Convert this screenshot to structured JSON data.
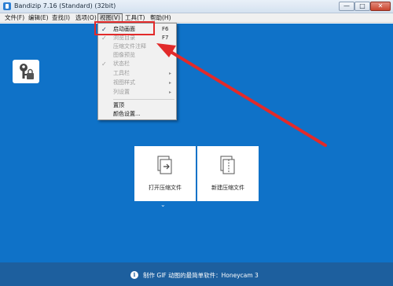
{
  "window": {
    "title": "Bandizip 7.16 (Standard) (32bit)",
    "controls": {
      "minimize": "—",
      "maximize": "□",
      "close": "✕"
    }
  },
  "menubar": {
    "items": [
      {
        "label": "文件(F)"
      },
      {
        "label": "编辑(E)"
      },
      {
        "label": "查找(I)"
      },
      {
        "label": "选项(O)"
      },
      {
        "label": "视图(V)"
      },
      {
        "label": "工具(T)"
      },
      {
        "label": "帮助(H)"
      }
    ]
  },
  "view_menu": {
    "items": [
      {
        "label": "启动画面",
        "shortcut": "F6",
        "checked": true,
        "enabled": true,
        "highlighted": true
      },
      {
        "label": "浏览目录",
        "shortcut": "F7",
        "checked": true,
        "enabled": false
      },
      {
        "label": "压缩文件注释",
        "shortcut": "",
        "checked": false,
        "enabled": false
      },
      {
        "label": "图像预览",
        "shortcut": "",
        "checked": false,
        "enabled": false
      },
      {
        "label": "状态栏",
        "shortcut": "",
        "checked": true,
        "enabled": false
      },
      {
        "label": "工具栏",
        "shortcut": "",
        "checked": false,
        "enabled": false,
        "submenu": true
      },
      {
        "label": "视图样式",
        "shortcut": "",
        "checked": false,
        "enabled": false,
        "submenu": true
      },
      {
        "label": "列设置",
        "shortcut": "",
        "checked": false,
        "enabled": false,
        "submenu": true
      },
      {
        "label": "置顶",
        "shortcut": "",
        "checked": false,
        "enabled": true
      },
      {
        "label": "颜色设置...",
        "shortcut": "",
        "checked": false,
        "enabled": true
      }
    ]
  },
  "start_screen": {
    "open_archive_label": "打开压缩文件",
    "new_archive_label": "新建压缩文件"
  },
  "statusbar": {
    "info_icon": "i",
    "text": "制作 GIF 动图的最简单软件：Honeycam 3"
  },
  "icons": {
    "check": "✓",
    "submenu_arrow": "▸",
    "expand": "⌄"
  },
  "colors": {
    "background": "#0f72c8",
    "statusbar": "#1d5f9e",
    "annotation": "#e22a2a"
  }
}
